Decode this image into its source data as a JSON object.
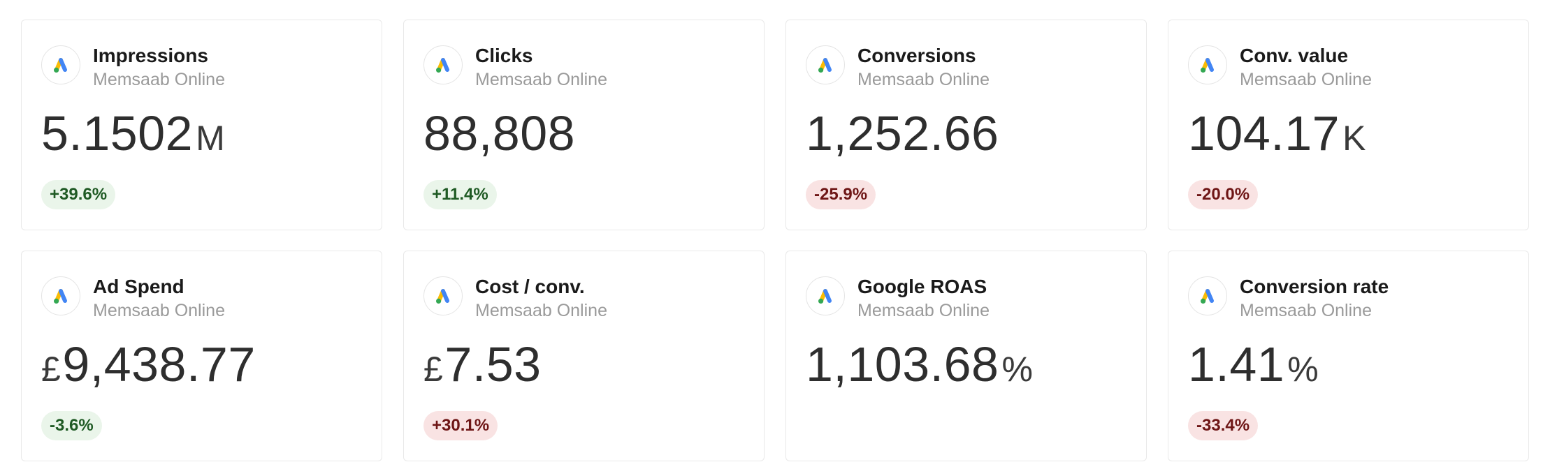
{
  "cards": [
    {
      "title": "Impressions",
      "subtitle": "Memsaab Online",
      "prefix": "",
      "value": "5.1502",
      "suffix": "M",
      "change": "+39.6%",
      "change_tone": "pos"
    },
    {
      "title": "Clicks",
      "subtitle": "Memsaab Online",
      "prefix": "",
      "value": "88,808",
      "suffix": "",
      "change": "+11.4%",
      "change_tone": "pos"
    },
    {
      "title": "Conversions",
      "subtitle": "Memsaab Online",
      "prefix": "",
      "value": "1,252.66",
      "suffix": "",
      "change": "-25.9%",
      "change_tone": "neg"
    },
    {
      "title": "Conv. value",
      "subtitle": "Memsaab Online",
      "prefix": "",
      "value": "104.17",
      "suffix": "K",
      "change": "-20.0%",
      "change_tone": "neg"
    },
    {
      "title": "Ad Spend",
      "subtitle": "Memsaab Online",
      "prefix": "£",
      "value": "9,438.77",
      "suffix": "",
      "change": "-3.6%",
      "change_tone": "pos"
    },
    {
      "title": "Cost / conv.",
      "subtitle": "Memsaab Online",
      "prefix": "£",
      "value": "7.53",
      "suffix": "",
      "change": "+30.1%",
      "change_tone": "neg"
    },
    {
      "title": "Google ROAS",
      "subtitle": "Memsaab Online",
      "prefix": "",
      "value": "1,103.68",
      "suffix": "%",
      "change": "",
      "change_tone": ""
    },
    {
      "title": "Conversion rate",
      "subtitle": "Memsaab Online",
      "prefix": "",
      "value": "1.41",
      "suffix": "%",
      "change": "-33.4%",
      "change_tone": "neg"
    }
  ],
  "icons": {
    "source_logo": "google-ads-icon"
  },
  "colors": {
    "positive_bg": "#eaf5ea",
    "positive_text": "#1f5a24",
    "negative_bg": "#f9e3e3",
    "negative_text": "#6e1616",
    "logo_blue": "#4285F4",
    "logo_yellow": "#FBBC04",
    "logo_green": "#34A853"
  }
}
